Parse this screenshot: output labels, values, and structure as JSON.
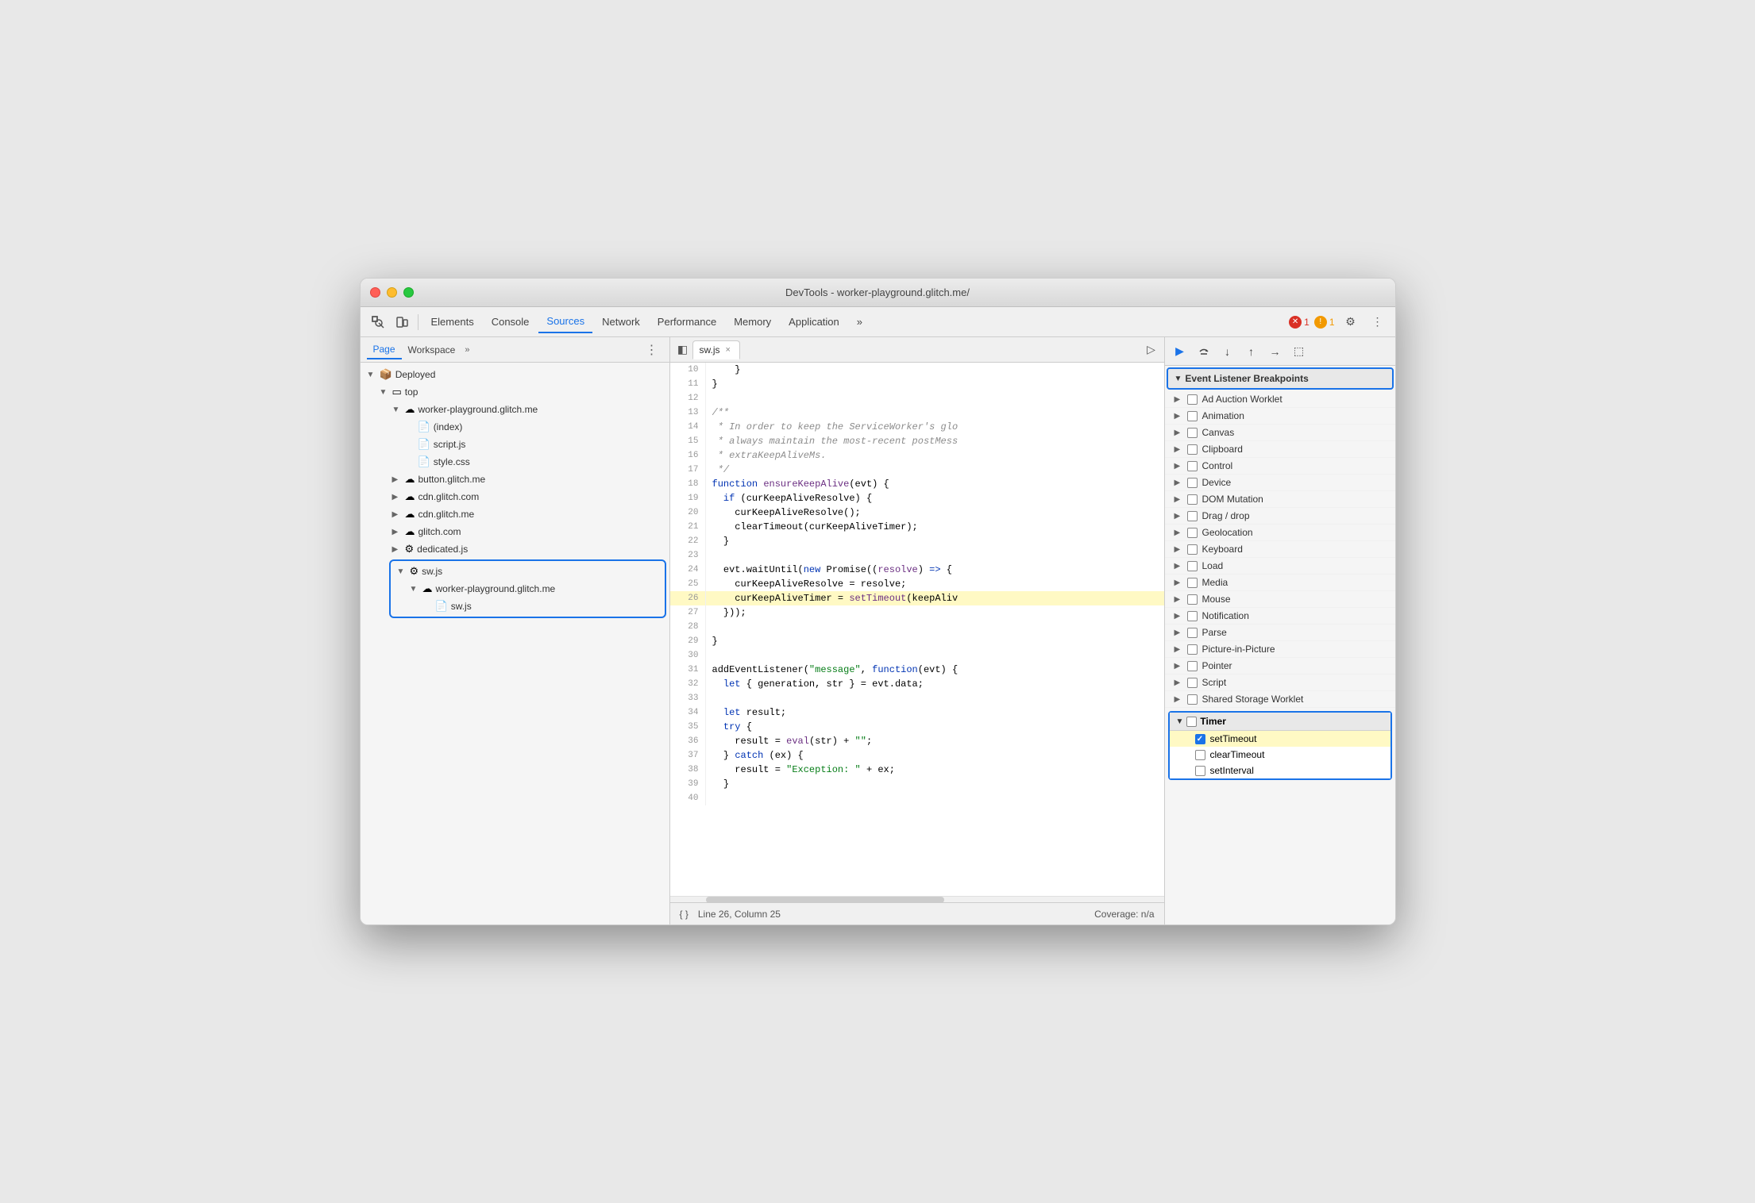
{
  "window": {
    "title": "DevTools - worker-playground.glitch.me/"
  },
  "titlebar": {
    "close": "●",
    "minimize": "●",
    "maximize": "●"
  },
  "toolbar": {
    "tabs": [
      "Elements",
      "Console",
      "Sources",
      "Network",
      "Performance",
      "Memory",
      "Application"
    ],
    "active_tab": "Sources",
    "more_tabs": "»",
    "error_count": "1",
    "warning_count": "1",
    "error_icon": "✕",
    "warning_icon": "⚠"
  },
  "left_panel": {
    "tabs": [
      "Page",
      "Workspace"
    ],
    "more": "»",
    "tree": [
      {
        "label": "Deployed",
        "type": "folder",
        "expanded": true,
        "indent": 0
      },
      {
        "label": "top",
        "type": "folder",
        "expanded": true,
        "indent": 1
      },
      {
        "label": "worker-playground.glitch.me",
        "type": "cloud",
        "expanded": true,
        "indent": 2
      },
      {
        "label": "(index)",
        "type": "file-white",
        "indent": 3
      },
      {
        "label": "script.js",
        "type": "file-orange",
        "indent": 3
      },
      {
        "label": "style.css",
        "type": "file-purple",
        "indent": 3
      },
      {
        "label": "button.glitch.me",
        "type": "cloud",
        "expanded": false,
        "indent": 2
      },
      {
        "label": "cdn.glitch.com",
        "type": "cloud",
        "expanded": false,
        "indent": 2
      },
      {
        "label": "cdn.glitch.me",
        "type": "cloud",
        "expanded": false,
        "indent": 2
      },
      {
        "label": "glitch.com",
        "type": "cloud",
        "expanded": false,
        "indent": 2
      },
      {
        "label": "dedicated.js",
        "type": "gear",
        "indent": 2
      },
      {
        "label": "sw.js",
        "type": "gear",
        "expanded": true,
        "indent": 2,
        "selected_group": true
      },
      {
        "label": "worker-playground.glitch.me",
        "type": "cloud",
        "expanded": true,
        "indent": 3,
        "selected_group": true
      },
      {
        "label": "sw.js",
        "type": "file-orange",
        "indent": 4,
        "selected_group": true
      }
    ]
  },
  "code_panel": {
    "file_tab": "sw.js",
    "lines": [
      {
        "num": 10,
        "content": "    }"
      },
      {
        "num": 11,
        "content": "}"
      },
      {
        "num": 12,
        "content": ""
      },
      {
        "num": 13,
        "content": "/**",
        "type": "comment"
      },
      {
        "num": 14,
        "content": " * In order to keep the ServiceWorker's glo",
        "type": "comment"
      },
      {
        "num": 15,
        "content": " * always maintain the most-recent postMess",
        "type": "comment"
      },
      {
        "num": 16,
        "content": " * extraKeepAliveMs.",
        "type": "comment"
      },
      {
        "num": 17,
        "content": " */",
        "type": "comment"
      },
      {
        "num": 18,
        "content": "function ensureKeepAlive(evt) {",
        "type": "code"
      },
      {
        "num": 19,
        "content": "  if (curKeepAliveResolve) {",
        "type": "code"
      },
      {
        "num": 20,
        "content": "    curKeepAliveResolve();",
        "type": "code"
      },
      {
        "num": 21,
        "content": "    clearTimeout(curKeepAliveTimer);",
        "type": "code"
      },
      {
        "num": 22,
        "content": "  }",
        "type": "code"
      },
      {
        "num": 23,
        "content": ""
      },
      {
        "num": 24,
        "content": "  evt.waitUntil(new Promise((resolve) => {",
        "type": "code"
      },
      {
        "num": 25,
        "content": "    curKeepAliveResolve = resolve;",
        "type": "code"
      },
      {
        "num": 26,
        "content": "    curKeepAliveTimer = setTimeout(keepAliv",
        "type": "code",
        "highlighted": true
      },
      {
        "num": 27,
        "content": "  }));",
        "type": "code"
      },
      {
        "num": 28,
        "content": ""
      },
      {
        "num": 29,
        "content": "}",
        "type": "code"
      },
      {
        "num": 30,
        "content": ""
      },
      {
        "num": 31,
        "content": "addEventListener(\"message\", function(evt) {",
        "type": "code"
      },
      {
        "num": 32,
        "content": "  let { generation, str } = evt.data;",
        "type": "code"
      },
      {
        "num": 33,
        "content": ""
      },
      {
        "num": 34,
        "content": "  let result;",
        "type": "code"
      },
      {
        "num": 35,
        "content": "  try {",
        "type": "code"
      },
      {
        "num": 36,
        "content": "    result = eval(str) + \"\";",
        "type": "code"
      },
      {
        "num": 37,
        "content": "  } catch (ex) {",
        "type": "code"
      },
      {
        "num": 38,
        "content": "    result = \"Exception: \" + ex;",
        "type": "code"
      },
      {
        "num": 39,
        "content": "  }",
        "type": "code"
      },
      {
        "num": 40,
        "content": ""
      }
    ],
    "status": {
      "pretty_print": "{ }",
      "position": "Line 26, Column 25",
      "coverage": "Coverage: n/a"
    }
  },
  "right_panel": {
    "debug_buttons": [
      "▶",
      "↺",
      "↓",
      "↑",
      "→",
      "⬚"
    ],
    "section_title": "Event Listener Breakpoints",
    "items": [
      {
        "label": "Ad Auction Worklet",
        "has_arrow": true,
        "checked": false
      },
      {
        "label": "Animation",
        "has_arrow": true,
        "checked": false
      },
      {
        "label": "Canvas",
        "has_arrow": true,
        "checked": false
      },
      {
        "label": "Clipboard",
        "has_arrow": true,
        "checked": false
      },
      {
        "label": "Control",
        "has_arrow": true,
        "checked": false
      },
      {
        "label": "Device",
        "has_arrow": true,
        "checked": false
      },
      {
        "label": "DOM Mutation",
        "has_arrow": true,
        "checked": false
      },
      {
        "label": "Drag / drop",
        "has_arrow": true,
        "checked": false
      },
      {
        "label": "Geolocation",
        "has_arrow": true,
        "checked": false
      },
      {
        "label": "Keyboard",
        "has_arrow": true,
        "checked": false
      },
      {
        "label": "Load",
        "has_arrow": true,
        "checked": false
      },
      {
        "label": "Media",
        "has_arrow": true,
        "checked": false
      },
      {
        "label": "Mouse",
        "has_arrow": true,
        "checked": false
      },
      {
        "label": "Notification",
        "has_arrow": true,
        "checked": false
      },
      {
        "label": "Parse",
        "has_arrow": true,
        "checked": false
      },
      {
        "label": "Picture-in-Picture",
        "has_arrow": true,
        "checked": false
      },
      {
        "label": "Pointer",
        "has_arrow": true,
        "checked": false
      },
      {
        "label": "Script",
        "has_arrow": true,
        "checked": false
      },
      {
        "label": "Shared Storage Worklet",
        "has_arrow": true,
        "checked": false
      }
    ],
    "timer_section": {
      "label": "Timer",
      "expanded": true,
      "items": [
        {
          "label": "setTimeout",
          "checked": true,
          "highlighted": true
        },
        {
          "label": "clearTimeout",
          "checked": false
        },
        {
          "label": "setInterval",
          "checked": false
        }
      ]
    }
  }
}
